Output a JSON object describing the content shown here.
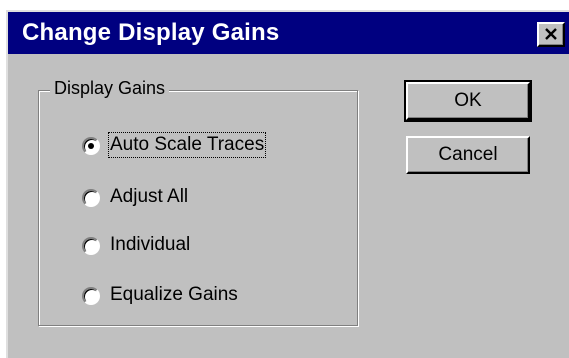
{
  "window": {
    "title": "Change Display Gains",
    "close_icon": "close-x-icon"
  },
  "group": {
    "legend": "Display Gains",
    "options": [
      {
        "label": "Auto Scale Traces",
        "selected": true
      },
      {
        "label": "Adjust All",
        "selected": false
      },
      {
        "label": "Individual",
        "selected": false
      },
      {
        "label": "Equalize Gains",
        "selected": false
      }
    ]
  },
  "buttons": {
    "ok_label": "OK",
    "cancel_label": "Cancel"
  },
  "colors": {
    "titlebar": "#000080",
    "dialog_face": "#c0c0c0"
  }
}
